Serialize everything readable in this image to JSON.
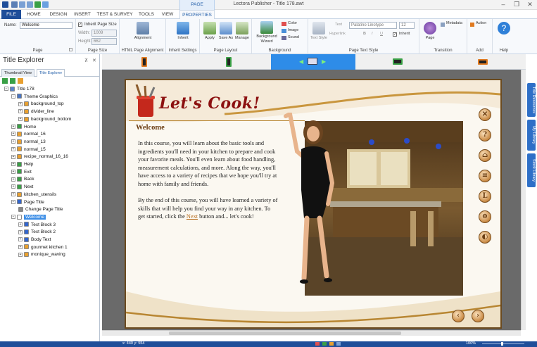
{
  "titlebar": {
    "title": "Lectora Publisher - Title 178.awt",
    "minimize": "–",
    "restore": "❐",
    "close": "✕"
  },
  "context_header": "PAGE",
  "tabs": [
    "FILE",
    "HOME",
    "DESIGN",
    "INSERT",
    "TEST & SURVEY",
    "TOOLS",
    "VIEW",
    "PROPERTIES"
  ],
  "ribbon": {
    "page": {
      "name_label": "Name:",
      "name_value": "Welcome",
      "group": "Page"
    },
    "page_size": {
      "inherit_label": "Inherit Page Size",
      "width_label": "Width:",
      "width_value": "1009",
      "height_label": "Height:",
      "height_value": "662",
      "group": "Page Size"
    },
    "html_align": {
      "button": "Alignment",
      "group": "HTML Page Alignment"
    },
    "inherit": {
      "button": "Inherit",
      "group": "Inherit Settings"
    },
    "layout": {
      "apply": "Apply",
      "save_as": "Save As",
      "manage": "Manage",
      "group": "Page Layout"
    },
    "background": {
      "wizard": "Background Wizard",
      "color": "Color",
      "image": "Image",
      "sound": "Sound",
      "group": "Background"
    },
    "text_style": {
      "text_style_btn": "Text Style",
      "text": "Text",
      "hyperlink": "Hyperlink",
      "font": "Palatino Linotype",
      "size": "12",
      "bold": "B",
      "italic": "I",
      "underline": "U",
      "inherit": "Inherit",
      "group": "Page Text Style"
    },
    "transition": {
      "page": "Page",
      "metadata": "Metadata",
      "group": "Transition"
    },
    "add": {
      "action": "Action",
      "group": "Add"
    },
    "help": {
      "button": "Help",
      "group": "Help"
    }
  },
  "explorer": {
    "title": "Title Explorer",
    "pin": "⊼",
    "close": "✕",
    "tabs": [
      "Thumbnail View",
      "Title Explorer"
    ],
    "tree": [
      {
        "label": "Title 178",
        "level": 0,
        "icon": "#5c84c8",
        "ex": "−"
      },
      {
        "label": "Theme Graphics",
        "level": 1,
        "icon": "#4a74c0",
        "ex": "−"
      },
      {
        "label": "background_top",
        "level": 2,
        "icon": "#e8a030",
        "ex": "+"
      },
      {
        "label": "divider_line",
        "level": 2,
        "icon": "#e8a030",
        "ex": "+"
      },
      {
        "label": "background_bottom",
        "level": 2,
        "icon": "#e8a030",
        "ex": "+"
      },
      {
        "label": "Home",
        "level": 1,
        "icon": "#3aa046",
        "ex": "+"
      },
      {
        "label": "normal_16",
        "level": 1,
        "icon": "#e8a030",
        "ex": "+"
      },
      {
        "label": "normal_13",
        "level": 1,
        "icon": "#e8a030",
        "ex": "+"
      },
      {
        "label": "normal_15",
        "level": 1,
        "icon": "#e8a030",
        "ex": "+"
      },
      {
        "label": "recipe_normal_16_16",
        "level": 1,
        "icon": "#e8a030",
        "ex": "+"
      },
      {
        "label": "Help",
        "level": 1,
        "icon": "#3aa046",
        "ex": "+"
      },
      {
        "label": "Exit",
        "level": 1,
        "icon": "#3aa046",
        "ex": "+"
      },
      {
        "label": "Back",
        "level": 1,
        "icon": "#3aa046",
        "ex": "+"
      },
      {
        "label": "Next",
        "level": 1,
        "icon": "#3aa046",
        "ex": "+"
      },
      {
        "label": "kitchen_utensils",
        "level": 1,
        "icon": "#e8a030",
        "ex": "+"
      },
      {
        "label": "Page Title",
        "level": 1,
        "icon": "#3366cc",
        "ex": "−"
      },
      {
        "label": "Change Page Title",
        "level": 2,
        "icon": "#888888",
        "ex": ""
      },
      {
        "label": "Welcome",
        "level": 1,
        "icon": "#ffffff",
        "ex": "−",
        "selected": true
      },
      {
        "label": "Text Block 3",
        "level": 2,
        "icon": "#3366cc",
        "ex": "+"
      },
      {
        "label": "Text Block 2",
        "level": 2,
        "icon": "#3366cc",
        "ex": "+"
      },
      {
        "label": "Body Text",
        "level": 2,
        "icon": "#3366cc",
        "ex": "+"
      },
      {
        "label": "gourmet kitchen 1",
        "level": 2,
        "icon": "#e8a030",
        "ex": "+"
      },
      {
        "label": "monique_waving",
        "level": 2,
        "icon": "#e8a030",
        "ex": "+"
      }
    ]
  },
  "side_tabs": [
    "Title Resources",
    "My Library",
    "Stock Library"
  ],
  "course": {
    "brand": "Let's Cook!",
    "heading": "Welcome",
    "para1": "In this course, you will learn about the basic tools and ingredients you'll need in your kitchen to prepare and cook your favorite meals. You'll even learn about food handling, measurement calculations, and more. Along the way, you'll have access to a variety of recipes that we hope you'll try at home with family and friends.",
    "para2_pre": "By the end of this course, you will have learned a variety of skills that will help you find your way in any kitchen. To get started, click the ",
    "para2_link": "Next",
    "para2_post": " button and... let's cook!",
    "nav_buttons": [
      "✕",
      "?",
      "⌂",
      "≡",
      "L",
      "⊖",
      "◐"
    ],
    "back": "‹",
    "next": "›"
  },
  "status": {
    "coords": "x: 440  y: 554",
    "zoom": "100%"
  }
}
